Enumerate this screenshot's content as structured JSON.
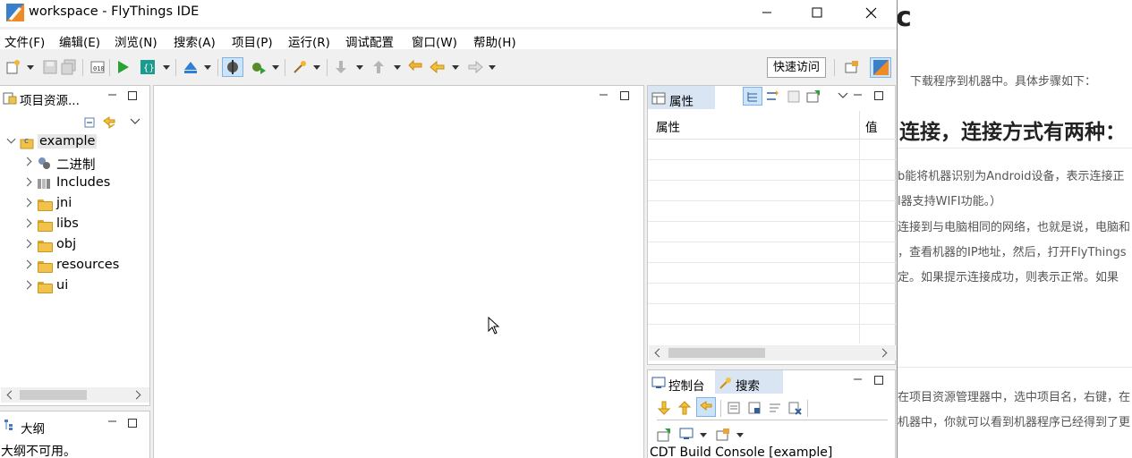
{
  "window": {
    "title": "workspace - FlyThings IDE"
  },
  "menus": [
    "文件(F)",
    "编辑(E)",
    "浏览(N)",
    "搜索(A)",
    "项目(P)",
    "运行(R)",
    "调试配置",
    "窗口(W)",
    "帮助(H)"
  ],
  "toolbar": {
    "quick_access": "快速访问"
  },
  "project_explorer": {
    "tab_label": "项目资源...",
    "items": [
      {
        "label": "example",
        "icon": "c-project-icon"
      },
      {
        "label": "二进制",
        "icon": "binaries-icon"
      },
      {
        "label": "Includes",
        "icon": "includes-icon"
      },
      {
        "label": "jni",
        "icon": "folder-icon"
      },
      {
        "label": "libs",
        "icon": "folder-icon"
      },
      {
        "label": "obj",
        "icon": "folder-icon"
      },
      {
        "label": "resources",
        "icon": "folder-icon"
      },
      {
        "label": "ui",
        "icon": "folder-icon"
      }
    ]
  },
  "outline": {
    "tab_label": "大纲",
    "message": "大纲不可用。"
  },
  "properties": {
    "tab_label": "属性",
    "col_property": "属性",
    "col_value": "值"
  },
  "console": {
    "tab_console": "控制台",
    "tab_search": "搜索",
    "title": "CDT Build Console [example]"
  },
  "background_doc": {
    "lines": [
      "下载程序到机器中。具体步骤如下：",
      "b连接，连接方式有两种：",
      "b能将机器识别为Android设备，表示连接正",
      "l器支持WIFI功能。）",
      "连接到与电脑相同的网络，也就是说，电脑和",
      "，查看机器的IP地址，然后，打开FlyThings",
      "定。如果提示连接成功，则表示正常。如果",
      "在项目资源管理器中，选中项目名，右键，在",
      "机器中，你就可以看到机器程序已经得到了更"
    ],
    "head_glyph": "c"
  },
  "colors": {
    "accent": "#0078d7",
    "tab_active": "#dae5f3"
  }
}
